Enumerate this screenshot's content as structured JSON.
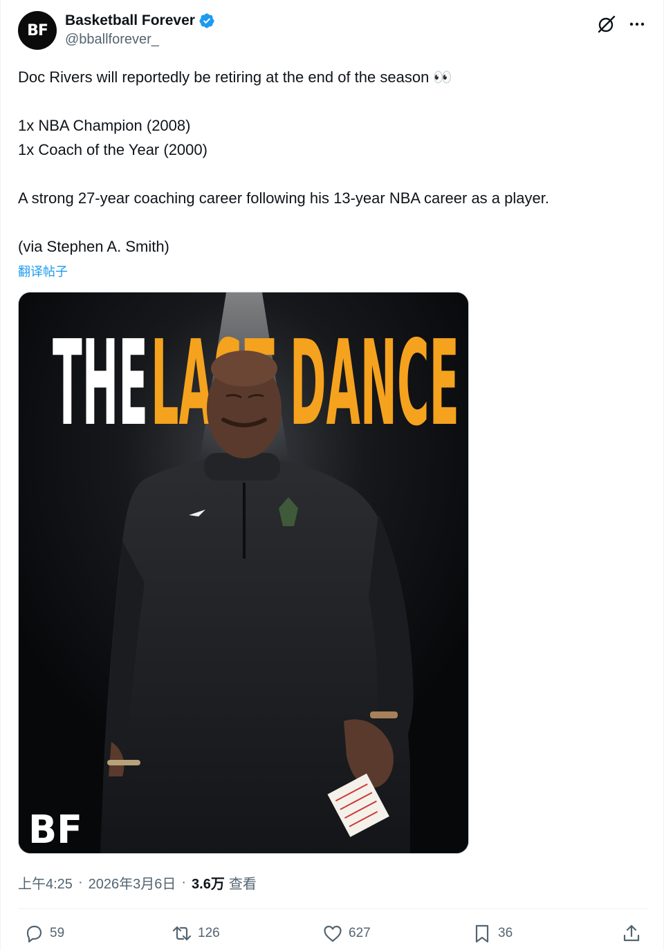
{
  "author": {
    "display_name": "Basketball Forever",
    "handle": "@bballforever_",
    "avatar_text": "BF"
  },
  "post": {
    "lines": [
      "Doc Rivers will reportedly be retiring at the end of the season 👀",
      "",
      "1x NBA Champion (2008)",
      "1x Coach of the Year (2000)",
      "",
      "A strong 27-year coaching career following his 13-year NBA career as a player.",
      "",
      "(via Stephen A. Smith)"
    ],
    "translate_label": "翻译帖子"
  },
  "media": {
    "headline_white": "THE",
    "headline_orange": "LAST DANCE",
    "watermark": "BF",
    "colors": {
      "orange": "#f5a21e",
      "white": "#ffffff",
      "background": "#0b0c0e"
    }
  },
  "meta": {
    "time": "上午4:25",
    "date": "2026年3月6日",
    "views_count": "3.6万",
    "views_label": "查看",
    "separator": "·"
  },
  "actions": {
    "replies": "59",
    "reposts": "126",
    "likes": "627",
    "bookmarks": "36"
  },
  "colors": {
    "accent": "#1d9bf0",
    "secondary_text": "#536471",
    "primary_text": "#0f1419"
  }
}
